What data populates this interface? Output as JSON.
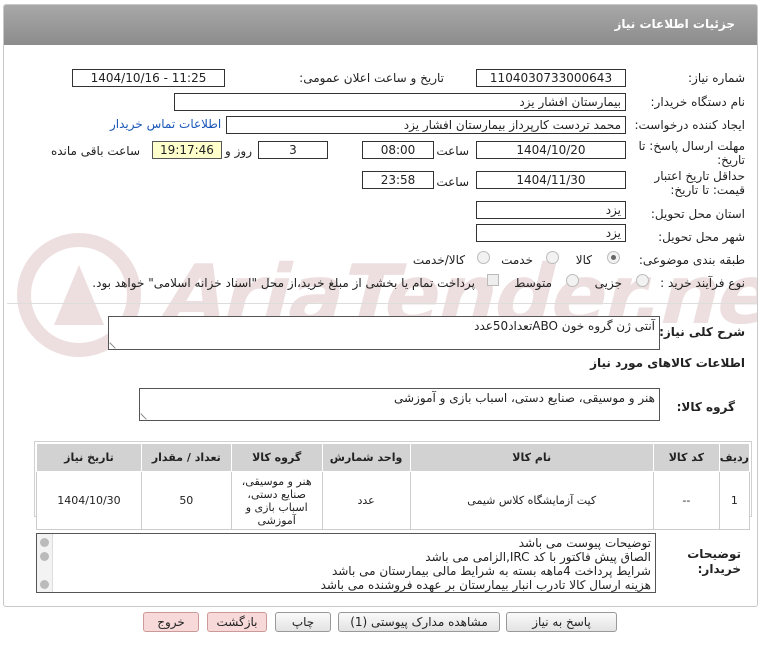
{
  "header": {
    "title": "جزئیات اطلاعات نیاز"
  },
  "fields": {
    "need_number_label": "شماره نیاز:",
    "need_number": "1104030733000643",
    "announce_label": "تاریخ و ساعت اعلان عمومی:",
    "announce_value": "1404/10/16 - 11:25",
    "buyer_label": "نام دستگاه خریدار:",
    "buyer": "بیمارستان افشار یزد",
    "creator_label": "ایجاد کننده درخواست:",
    "creator": "محمد تردست کارپرداز بیمارستان افشار یزد",
    "contact_link": "اطلاعات تماس خریدار",
    "deadline_label_1": "مهلت ارسال پاسخ: تا",
    "deadline_label_2": "تاریخ:",
    "deadline_date": "1404/10/20",
    "time_label": "ساعت",
    "deadline_time": "08:00",
    "days_value": "3",
    "days_label": "روز و",
    "remaining_time": "19:17:46",
    "remaining_label": "ساعت باقی مانده",
    "price_label_1": "حداقل تاریخ اعتبار",
    "price_label_2": "قیمت: تا تاریخ:",
    "price_date": "1404/11/30",
    "price_time": "23:58",
    "province_label": "استان محل تحویل:",
    "province": "یزد",
    "city_label": "شهر محل تحویل:",
    "city": "یزد",
    "category_label": "طبقه بندی موضوعی:",
    "category_options": [
      "کالا",
      "خدمت",
      "کالا/خدمت"
    ],
    "process_label": "نوع فرآیند خرید :",
    "process_options": [
      "جزیی",
      "متوسط"
    ],
    "payment_note": "پرداخت تمام یا بخشی از مبلغ خرید،از محل \"اسناد خزانه اسلامی\" خواهد بود."
  },
  "summary": {
    "label": "شرح کلی نیاز:",
    "text": "آنتی ژن گروه خون ABOتعداد50عدد"
  },
  "goods_info_title": "اطلاعات کالاهای مورد نیاز",
  "goods_group": {
    "label": "گروه کالا:",
    "text": "هنر و موسیقی، صنایع دستی، اسباب بازی و آموزشی"
  },
  "table": {
    "headers": [
      "ردیف",
      "کد کالا",
      "نام کالا",
      "واحد شمارش",
      "گروه کالا",
      "تعداد / مقدار",
      "تاریخ نیاز"
    ],
    "rows": [
      {
        "row": "1",
        "code": "--",
        "name": "کیت آزمایشگاه کلاس شیمی",
        "unit": "عدد",
        "group": "هنر و موسیقی، صنایع دستی، اسباب بازی و آموزشی",
        "qty": "50",
        "date": "1404/10/30"
      }
    ]
  },
  "notes": {
    "label_1": "توضیحات",
    "label_2": "خریدار:",
    "lines": [
      "توضیحات پیوست می باشد",
      "الصاق پیش فاکتور با کد  IRC,الزامی می باشد",
      "شرایط پرداخت  4ماهه بسته به شرایط مالی بیمارستان می باشد",
      "هزینه ارسال کالا تادرب انبار بیمارستان بر عهده فروشنده می باشد"
    ]
  },
  "buttons": {
    "reply": "پاسخ به نیاز",
    "attachments": "مشاهده مدارک پیوستی (1)",
    "print": "چاپ",
    "back": "بازگشت",
    "exit": "خروج"
  },
  "watermark": {
    "text": "AriaTender.net"
  }
}
